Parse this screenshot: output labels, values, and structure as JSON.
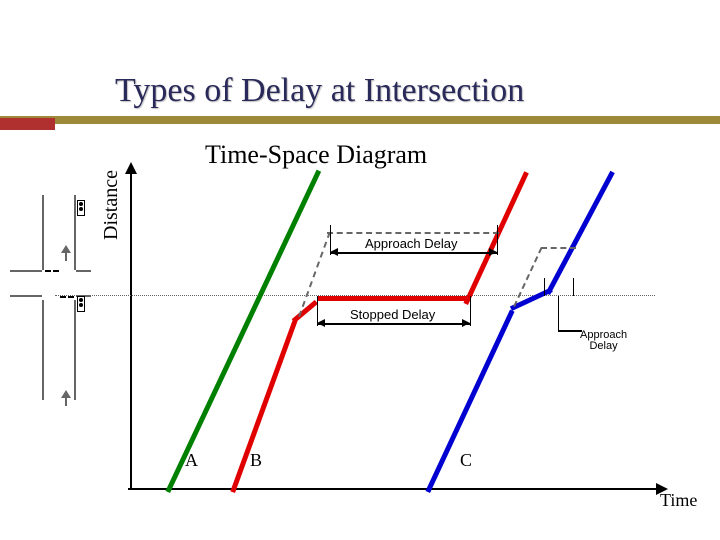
{
  "title": "Types of Delay at Intersection",
  "subtitle": "Time-Space Diagram",
  "axes": {
    "x": "Time",
    "y": "Distance"
  },
  "labels": {
    "approach_delay": "Approach Delay",
    "stopped_delay": "Stopped Delay",
    "approach_delay_small": "Approach\nDelay"
  },
  "vehicles": {
    "A": "A",
    "B": "B",
    "C": "C"
  },
  "colors": {
    "A": "#008000",
    "B": "#e00000",
    "C": "#0000d0",
    "accent_bar": "#9c8a3a",
    "accent_block": "#b03030"
  }
}
